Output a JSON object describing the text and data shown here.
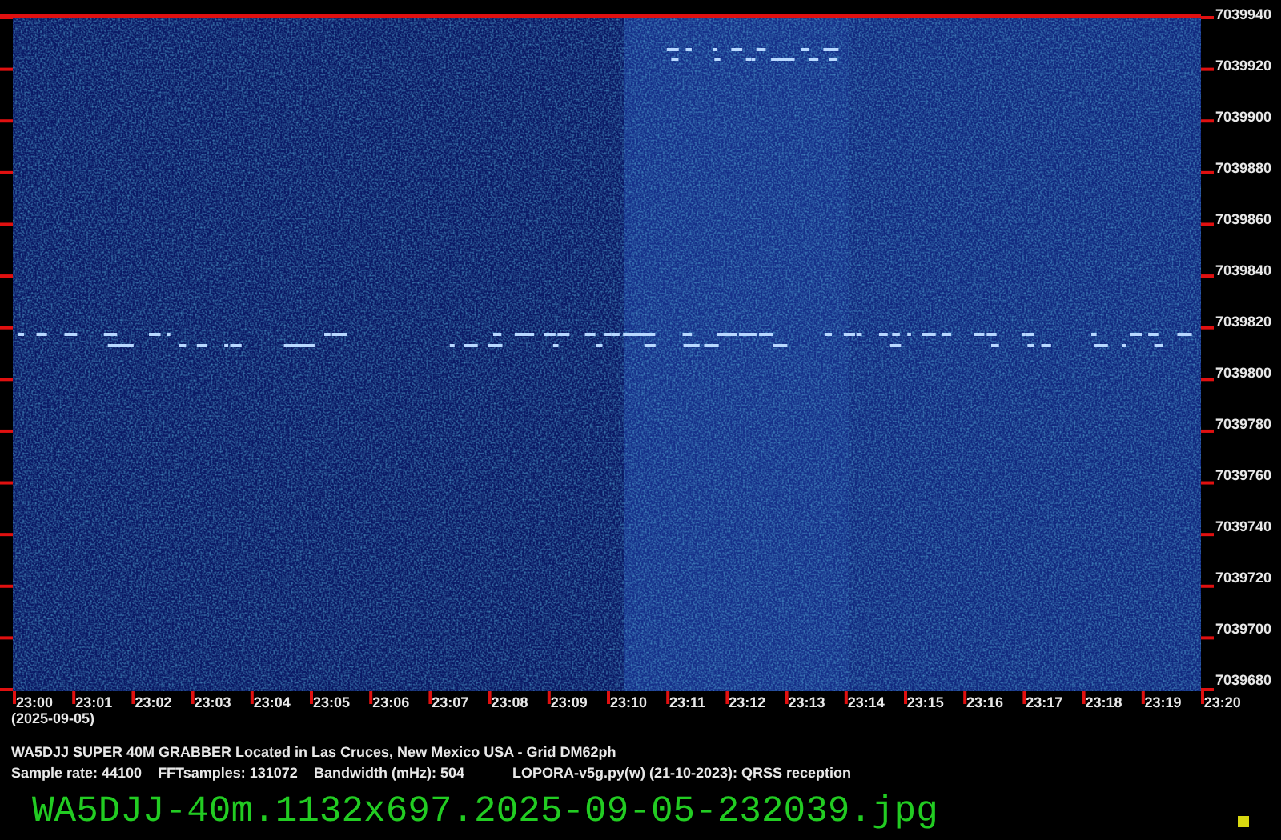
{
  "frequency_axis": {
    "labels": [
      "7039940",
      "7039920",
      "7039900",
      "7039880",
      "7039860",
      "7039840",
      "7039820",
      "7039800",
      "7039780",
      "7039760",
      "7039740",
      "7039720",
      "7039700",
      "7039680"
    ]
  },
  "time_axis": {
    "labels": [
      "23:00",
      "23:01",
      "23:02",
      "23:03",
      "23:04",
      "23:05",
      "23:06",
      "23:07",
      "23:08",
      "23:09",
      "23:10",
      "23:11",
      "23:12",
      "23:13",
      "23:14",
      "23:15",
      "23:16",
      "23:17",
      "23:18",
      "23:19",
      "23:20"
    ],
    "date": "(2025-09-05)"
  },
  "caption": {
    "station": "WA5DJJ SUPER 40M GRABBER Located in Las Cruces, New Mexico USA - Grid DM62ph",
    "sample_rate": "Sample rate: 44100",
    "fft_samples": "FFTsamples: 131072",
    "bandwidth": "Bandwidth (mHz): 504",
    "software": "LOPORA-v5g.py(w) (21-10-2023): QRSS reception"
  },
  "filename": "WA5DJJ-40m.1132x697.2025-09-05-232039.jpg"
}
